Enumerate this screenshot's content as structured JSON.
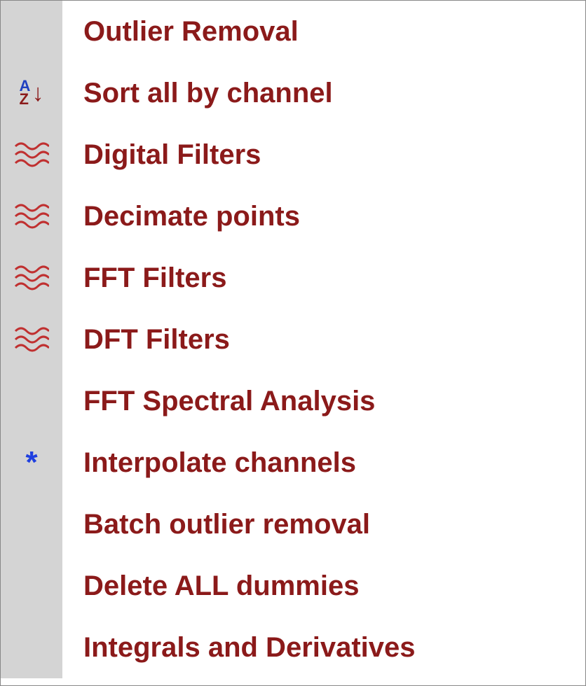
{
  "menu": {
    "items": [
      {
        "icon": "none",
        "label": "Outlier Removal"
      },
      {
        "icon": "sort",
        "label": "Sort all by channel"
      },
      {
        "icon": "wave",
        "label": "Digital Filters"
      },
      {
        "icon": "wave",
        "label": "Decimate points"
      },
      {
        "icon": "wave",
        "label": "FFT Filters"
      },
      {
        "icon": "wave",
        "label": "DFT Filters"
      },
      {
        "icon": "none",
        "label": "FFT Spectral Analysis"
      },
      {
        "icon": "asterisk",
        "label": "Interpolate channels"
      },
      {
        "icon": "none",
        "label": "Batch outlier removal"
      },
      {
        "icon": "none",
        "label": "Delete ALL dummies"
      },
      {
        "icon": "none",
        "label": "Integrals and Derivatives"
      }
    ]
  }
}
